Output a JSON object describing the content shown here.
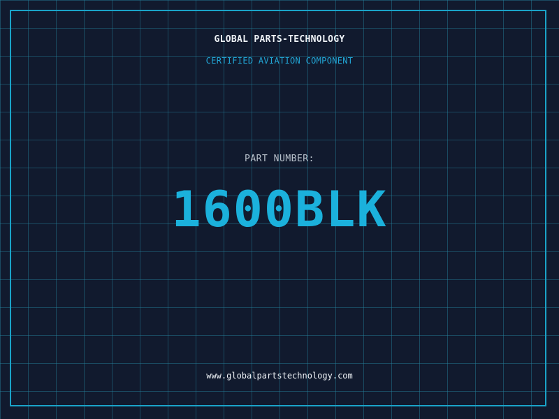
{
  "header": {
    "company": "GLOBAL PARTS-TECHNOLOGY",
    "subtitle": "CERTIFIED AVIATION COMPONENT"
  },
  "part": {
    "label": "PART NUMBER:",
    "number": "1600BLK"
  },
  "footer": {
    "website": "www.globalpartstechnology.com"
  },
  "colors": {
    "background": "#111a2e",
    "grid": "#2684a0",
    "frame": "#1aa3c8",
    "accent": "#1bb1dc",
    "text": "#eef2f6"
  }
}
